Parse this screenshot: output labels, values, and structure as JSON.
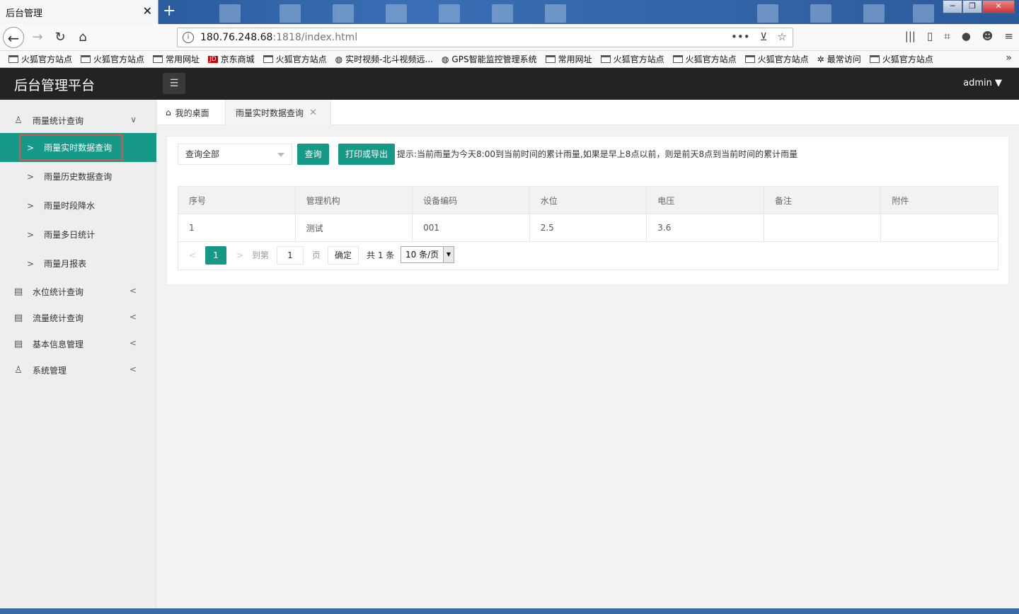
{
  "browser": {
    "tab_title": "后台管理",
    "url_host": "180.76.248.68",
    "url_rest": ":1818/index.html",
    "bookmarks": [
      "火狐官方站点",
      "火狐官方站点",
      "常用网址",
      "京东商城",
      "火狐官方站点",
      "实时视频-北斗视频远...",
      "GPS智能监控管理系统",
      "常用网址",
      "火狐官方站点",
      "火狐官方站点",
      "火狐官方站点",
      "最常访问",
      "火狐官方站点"
    ],
    "jd_badge": "JD"
  },
  "header": {
    "brand": "后台管理平台",
    "user": "admin"
  },
  "sidebar": {
    "group1": "雨量统计查询",
    "subs": [
      "雨量实时数据查询",
      "雨量历史数据查询",
      "雨量时段降水",
      "雨量多日统计",
      "雨量月报表"
    ],
    "groups": [
      "水位统计查询",
      "流量统计查询",
      "基本信息管理",
      "系统管理"
    ]
  },
  "tabs": {
    "home": "我的桌面",
    "current": "雨量实时数据查询"
  },
  "toolbar": {
    "select_value": "查询全部",
    "query_btn": "查询",
    "export_btn": "打印或导出",
    "hint": "提示:当前雨量为今天8:00到当前时间的累计雨量,如果是早上8点以前，则是前天8点到当前时间的累计雨量"
  },
  "table": {
    "headers": [
      "序号",
      "管理机构",
      "设备编码",
      "水位",
      "电压",
      "备注",
      "附件"
    ],
    "rows": [
      [
        "1",
        "测试",
        "001",
        "2.5",
        "3.6",
        "",
        ""
      ]
    ]
  },
  "pager": {
    "current": "1",
    "goto_label": "到第",
    "goto_value": "1",
    "page_label": "页",
    "ok": "确定",
    "total": "共 1 条",
    "size": "10 条/页"
  },
  "colors": {
    "accent": "#169a87",
    "header_bg": "#232323",
    "highlight_border": "#d9534f"
  }
}
